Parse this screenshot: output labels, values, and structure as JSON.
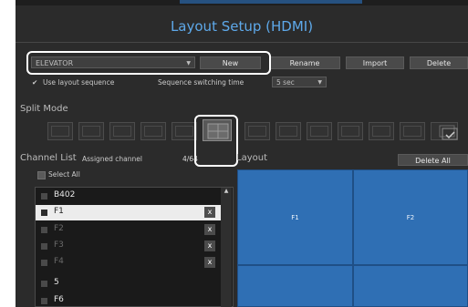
{
  "header": {
    "title": "Layout Setup (HDMI)"
  },
  "toolbar": {
    "layout_value": "ELEVATOR",
    "new_label": "New",
    "rename_label": "Rename",
    "import_label": "Import",
    "delete_label": "Delete"
  },
  "options": {
    "use_layout_sequence": "Use layout sequence",
    "sequence_switching_time": "Sequence switching time",
    "sequence_switching_value": "5 sec"
  },
  "split_mode": {
    "label": "Split Mode"
  },
  "channel_list": {
    "title": "Channel List",
    "assigned_label": "Assigned channel",
    "assigned_value": "4/64",
    "select_all": "Select All",
    "items": [
      {
        "label": "B402",
        "x": false,
        "dim": false
      },
      {
        "label": "F1",
        "x": true,
        "dim": false
      },
      {
        "label": "F2",
        "x": true,
        "dim": true
      },
      {
        "label": "F3",
        "x": true,
        "dim": true
      },
      {
        "label": "F4",
        "x": true,
        "dim": true
      },
      {
        "label": "5",
        "x": false,
        "dim": false
      },
      {
        "label": "F6",
        "x": false,
        "dim": false
      }
    ],
    "remove_symbol": "x"
  },
  "layout_panel": {
    "title": "Layout",
    "delete_all_label": "Delete All",
    "cells": [
      "F1",
      "F2",
      "",
      ""
    ]
  }
}
